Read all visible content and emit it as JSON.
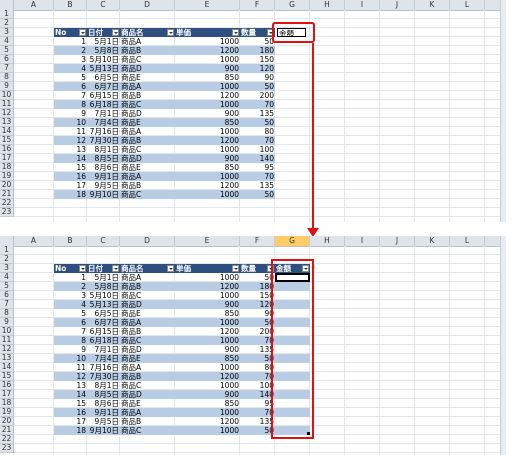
{
  "columns": [
    "A",
    "B",
    "C",
    "D",
    "E",
    "F",
    "G",
    "H",
    "I",
    "J",
    "K",
    "L"
  ],
  "rows": [
    "1",
    "2",
    "3",
    "4",
    "5",
    "6",
    "7",
    "8",
    "9",
    "10",
    "11",
    "12",
    "13",
    "14",
    "15",
    "16",
    "17",
    "18",
    "19",
    "20",
    "21",
    "22",
    "23"
  ],
  "rows_bottom": [
    "1",
    "2",
    "3",
    "4",
    "5",
    "6",
    "7",
    "8",
    "9",
    "10",
    "11",
    "12",
    "13",
    "14",
    "15",
    "16",
    "17",
    "18",
    "19",
    "20",
    "21",
    "22",
    "23"
  ],
  "table": {
    "headers": [
      "No",
      "日付",
      "商品名",
      "単価",
      "数量"
    ],
    "new_header": "金額",
    "records": [
      [
        "1",
        "5月1日",
        "商品A",
        "1000",
        "50"
      ],
      [
        "2",
        "5月8日",
        "商品B",
        "1200",
        "180"
      ],
      [
        "3",
        "5月10日",
        "商品C",
        "1000",
        "150"
      ],
      [
        "4",
        "5月13日",
        "商品D",
        "900",
        "120"
      ],
      [
        "5",
        "6月5日",
        "商品E",
        "850",
        "90"
      ],
      [
        "6",
        "6月7日",
        "商品A",
        "1000",
        "50"
      ],
      [
        "7",
        "6月15日",
        "商品B",
        "1200",
        "200"
      ],
      [
        "8",
        "6月18日",
        "商品C",
        "1000",
        "70"
      ],
      [
        "9",
        "7月1日",
        "商品D",
        "900",
        "135"
      ],
      [
        "10",
        "7月4日",
        "商品E",
        "850",
        "50"
      ],
      [
        "11",
        "7月16日",
        "商品A",
        "1000",
        "80"
      ],
      [
        "12",
        "7月30日",
        "商品B",
        "1200",
        "70"
      ],
      [
        "13",
        "8月1日",
        "商品C",
        "1000",
        "100"
      ],
      [
        "14",
        "8月5日",
        "商品D",
        "900",
        "140"
      ],
      [
        "15",
        "8月6日",
        "商品E",
        "850",
        "95"
      ],
      [
        "16",
        "9月1日",
        "商品A",
        "1000",
        "70"
      ],
      [
        "17",
        "9月5日",
        "商品B",
        "1200",
        "135"
      ],
      [
        "18",
        "9月10日",
        "商品C",
        "1000",
        "50"
      ]
    ]
  },
  "colors": {
    "header_bg": "#2e4f7f",
    "band_bg": "#b8cce4",
    "highlight": "#e01010",
    "selected_column_header": "#ffcc66"
  },
  "icons": {
    "filter": "filter-dropdown-icon",
    "arrow": "down-arrow-icon",
    "autocorrect": "smart-tag-icon"
  }
}
